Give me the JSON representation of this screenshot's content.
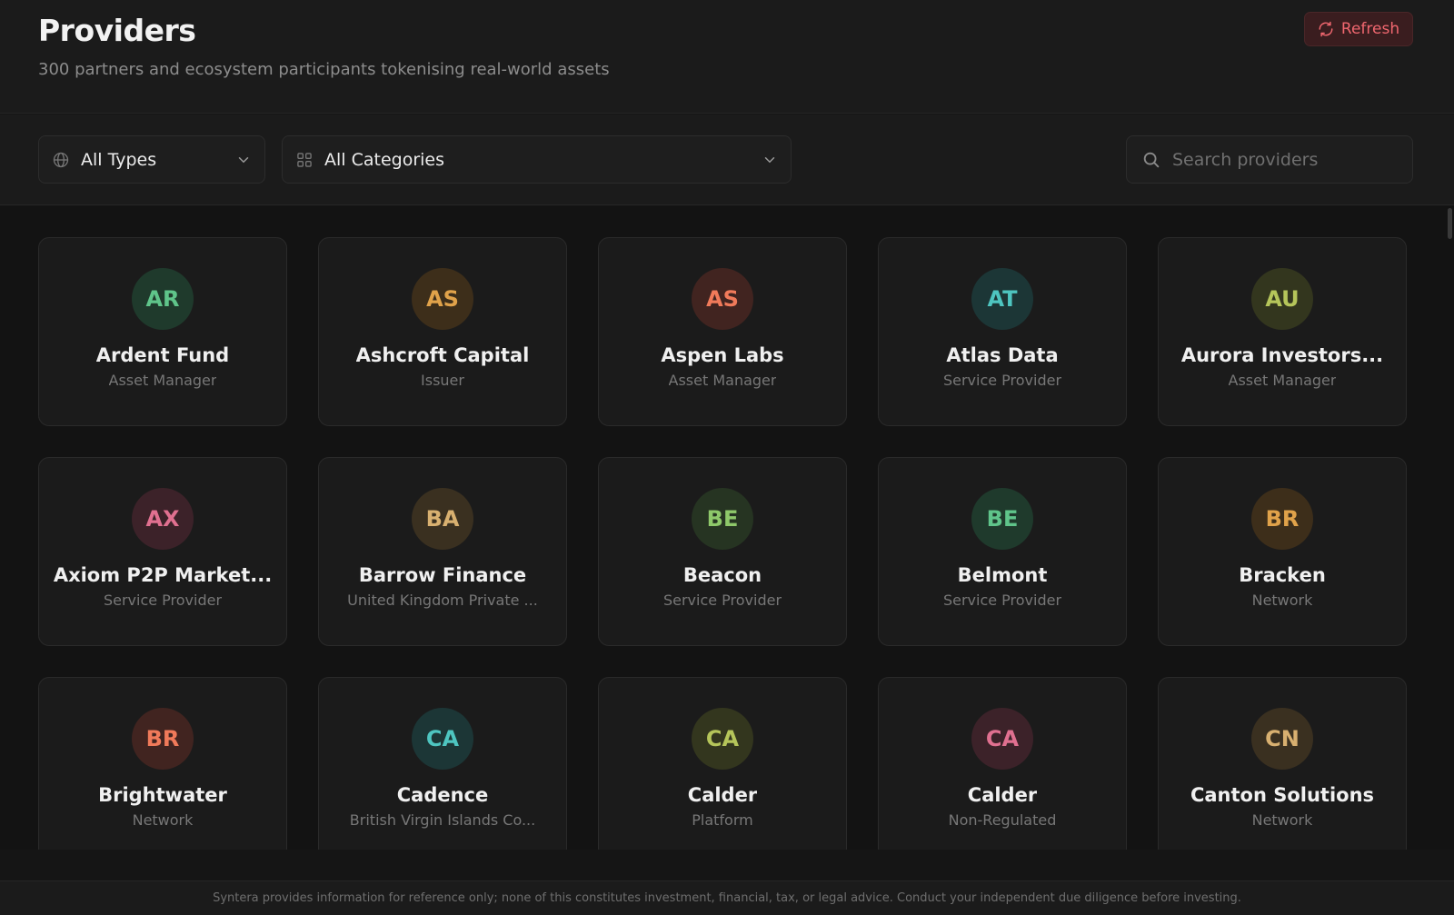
{
  "header": {
    "title": "Providers",
    "subtitle": "300 partners and ecosystem participants tokenising real-world assets",
    "refresh_label": "Refresh"
  },
  "filters": {
    "types_label": "All Types",
    "categories_label": "All Categories",
    "search_placeholder": "Search providers"
  },
  "providers": [
    {
      "initials": "AR",
      "name": "Ardent Fund",
      "type": "Asset Manager",
      "fg": "#5fc48a",
      "bg": "#1f3a2c"
    },
    {
      "initials": "AS",
      "name": "Ashcroft Capital",
      "type": "Issuer",
      "fg": "#e0a24a",
      "bg": "#3d2e1a"
    },
    {
      "initials": "AS",
      "name": "Aspen Labs",
      "type": "Asset Manager",
      "fg": "#f07a5a",
      "bg": "#412420"
    },
    {
      "initials": "AT",
      "name": "Atlas Data",
      "type": "Service Provider",
      "fg": "#4ec5c0",
      "bg": "#1c3636"
    },
    {
      "initials": "AU",
      "name": "Aurora Investors...",
      "type": "Asset Manager",
      "fg": "#b5c55a",
      "bg": "#33361e"
    },
    {
      "initials": "AX",
      "name": "Axiom P2P Market...",
      "type": "Service Provider",
      "fg": "#e07090",
      "bg": "#3c2229"
    },
    {
      "initials": "BA",
      "name": "Barrow Finance",
      "type": "United Kingdom Private ...",
      "fg": "#d8b070",
      "bg": "#3a3020"
    },
    {
      "initials": "BE",
      "name": "Beacon",
      "type": "Service Provider",
      "fg": "#8ec86a",
      "bg": "#263422"
    },
    {
      "initials": "BE",
      "name": "Belmont",
      "type": "Service Provider",
      "fg": "#5fc48a",
      "bg": "#1f3a2c"
    },
    {
      "initials": "BR",
      "name": "Bracken",
      "type": "Network",
      "fg": "#e0a24a",
      "bg": "#3d2e1a"
    },
    {
      "initials": "BR",
      "name": "Brightwater",
      "type": "Network",
      "fg": "#f07a5a",
      "bg": "#412420"
    },
    {
      "initials": "CA",
      "name": "Cadence",
      "type": "British Virgin Islands Co...",
      "fg": "#4ec5c0",
      "bg": "#1c3636"
    },
    {
      "initials": "CA",
      "name": "Calder",
      "type": "Platform",
      "fg": "#b5c55a",
      "bg": "#33361e"
    },
    {
      "initials": "CA",
      "name": "Calder",
      "type": "Non-Regulated",
      "fg": "#e07090",
      "bg": "#3c2229"
    },
    {
      "initials": "CN",
      "name": "Canton Solutions",
      "type": "Network",
      "fg": "#d8b070",
      "bg": "#3a3020"
    }
  ],
  "footer": {
    "disclaimer": "Syntera provides information for reference only; none of this constitutes investment, financial, tax, or legal advice. Conduct your independent due diligence before investing."
  }
}
